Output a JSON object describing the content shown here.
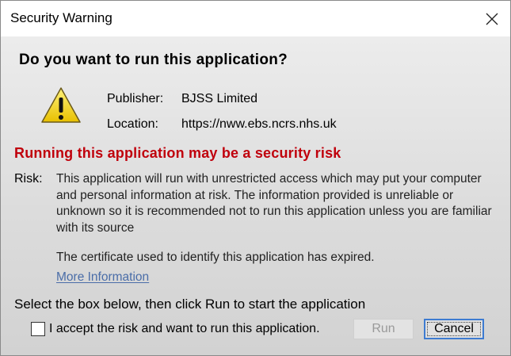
{
  "window": {
    "title": "Security Warning",
    "close_icon": "close-icon"
  },
  "main": {
    "question": "Do you want to run this application?",
    "warning_icon": "warning-triangle-icon",
    "publisher_label": "Publisher:",
    "publisher_value": "BJSS Limited",
    "location_label": "Location:",
    "location_value": "https://nww.ebs.ncrs.nhs.uk",
    "risk_headline": "Running this application may be a security risk",
    "risk_label": "Risk:",
    "risk_text": "This application will run with unrestricted access which may put your computer and personal information at risk. The information provided is unreliable or unknown so it is recommended not to run this application unless you are familiar with its source",
    "certificate_text": "The certificate used to identify this application has expired.",
    "more_info_link": "More Information",
    "instruction": "Select the box below, then click Run to start the application",
    "accept_checkbox_label": "I accept the risk and want to run this application.",
    "accept_checked": false,
    "run_button": "Run",
    "run_enabled": false,
    "cancel_button": "Cancel"
  },
  "colors": {
    "risk_headline": "#c0000c",
    "link": "#4a6da8",
    "focus_border": "#3d7bd1"
  }
}
